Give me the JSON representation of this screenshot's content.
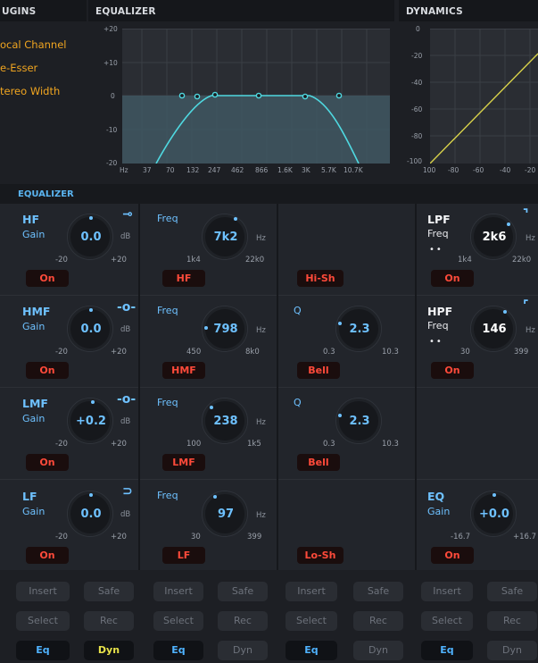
{
  "headers": {
    "plugins": "UGINS",
    "equalizer": "EQUALIZER",
    "dynamics": "DYNAMICS"
  },
  "plugins": [
    "ocal Channel",
    "e-Esser",
    "tereo Width"
  ],
  "eq_graph": {
    "y_ticks": [
      "+20",
      "+10",
      "0",
      "-10",
      "-20"
    ],
    "x_ticks": [
      "Hz",
      "37",
      "70",
      "132",
      "247",
      "462",
      "866",
      "1.6K",
      "3K",
      "5.7K",
      "10.7K"
    ],
    "curve_color": "#4fd8e0"
  },
  "dyn_graph": {
    "y_ticks": [
      "0",
      "-20",
      "-40",
      "-60",
      "-80",
      "-100"
    ],
    "x_ticks": [
      "100",
      "-80",
      "-60",
      "-40",
      "-20"
    ],
    "line_color": "#d8d24a"
  },
  "section_title": "EQUALIZER",
  "bands": {
    "hf": {
      "name": "HF",
      "gain_label": "Gain",
      "gain": "0.0",
      "unit": "dB",
      "min": "-20",
      "max": "+20",
      "on": "On",
      "freq_label": "Freq",
      "freq": "7k2",
      "freq_unit": "Hz",
      "freq_min": "1k4",
      "freq_max": "22k0",
      "type": "HF",
      "shape": "Hi-Sh"
    },
    "hmf": {
      "name": "HMF",
      "gain_label": "Gain",
      "gain": "0.0",
      "unit": "dB",
      "min": "-20",
      "max": "+20",
      "on": "On",
      "freq_label": "Freq",
      "freq": "798",
      "freq_unit": "Hz",
      "freq_min": "450",
      "freq_max": "8k0",
      "type": "HMF",
      "q_label": "Q",
      "q": "2.3",
      "q_min": "0.3",
      "q_max": "10.3",
      "shape": "Bell"
    },
    "lmf": {
      "name": "LMF",
      "gain_label": "Gain",
      "gain": "+0.2",
      "unit": "dB",
      "min": "-20",
      "max": "+20",
      "on": "On",
      "freq_label": "Freq",
      "freq": "238",
      "freq_unit": "Hz",
      "freq_min": "100",
      "freq_max": "1k5",
      "type": "LMF",
      "q_label": "Q",
      "q": "2.3",
      "q_min": "0.3",
      "q_max": "10.3",
      "shape": "Bell"
    },
    "lf": {
      "name": "LF",
      "gain_label": "Gain",
      "gain": "0.0",
      "unit": "dB",
      "min": "-20",
      "max": "+20",
      "on": "On",
      "freq_label": "Freq",
      "freq": "97",
      "freq_unit": "Hz",
      "freq_min": "30",
      "freq_max": "399",
      "type": "LF",
      "shape": "Lo-Sh"
    }
  },
  "filters": {
    "lpf": {
      "name": "LPF",
      "freq_label": "Freq",
      "freq": "2k6",
      "unit": "Hz",
      "min": "1k4",
      "max": "22k0",
      "on": "On",
      "dots": "••"
    },
    "hpf": {
      "name": "HPF",
      "freq_label": "Freq",
      "freq": "146",
      "unit": "Hz",
      "min": "30",
      "max": "399",
      "on": "On",
      "dots": "••"
    },
    "eq": {
      "name": "EQ",
      "gain_label": "Gain",
      "gain": "+0.0",
      "min": "-16.7",
      "max": "+16.7",
      "on": "On"
    }
  },
  "strip": {
    "insert": "Insert",
    "safe": "Safe",
    "select": "Select",
    "rec": "Rec",
    "eq": "Eq",
    "dyn": "Dyn"
  }
}
